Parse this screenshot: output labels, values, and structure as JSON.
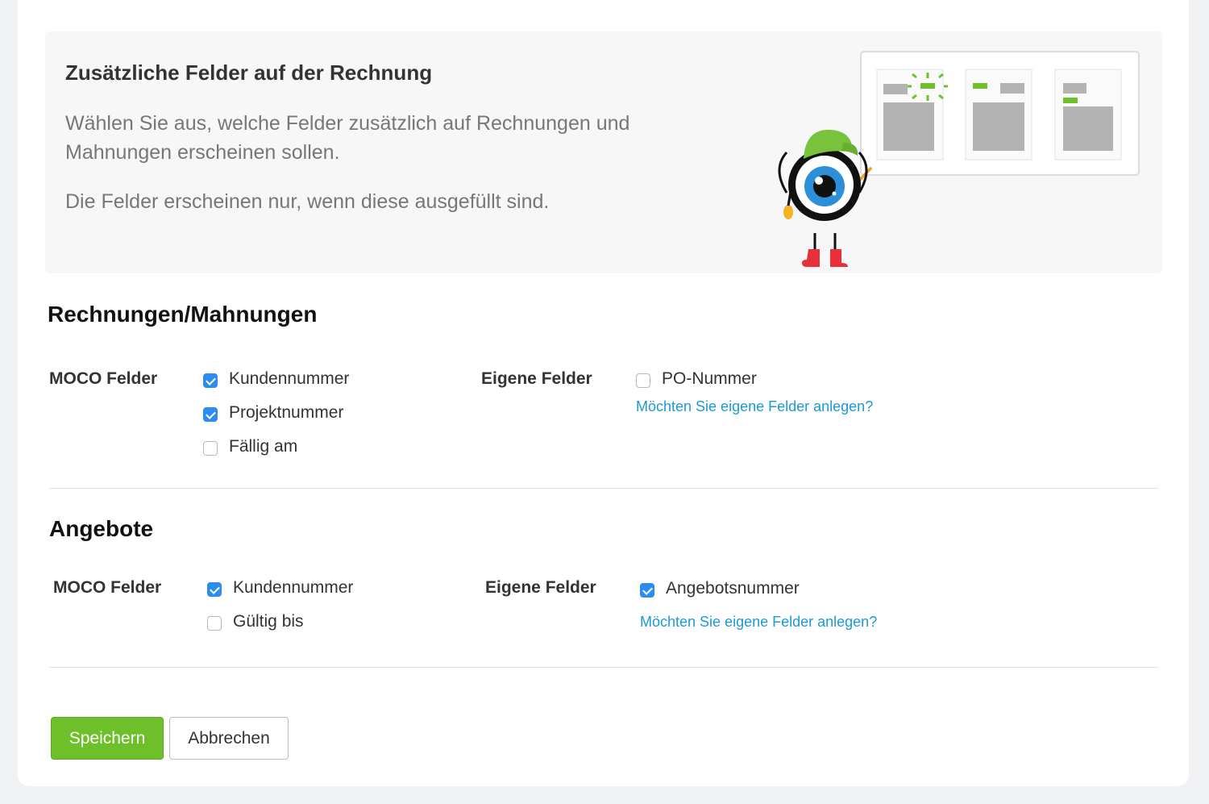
{
  "intro": {
    "title": "Zusätzliche Felder auf der Rechnung",
    "text": "Wählen Sie aus, welche Felder zusätzlich auf Rechnungen und Mahnungen erscheinen sollen.",
    "note": "Die Felder erscheinen nur, wenn diese ausgefüllt sind."
  },
  "invoices": {
    "title": "Rechnungen/Mahnungen",
    "moco_label": "MOCO Felder",
    "moco_fields": [
      {
        "label": "Kundennummer",
        "checked": true
      },
      {
        "label": "Projektnummer",
        "checked": true
      },
      {
        "label": "Fällig am",
        "checked": false
      }
    ],
    "custom_label": "Eigene Felder",
    "custom_fields": [
      {
        "label": "PO-Nummer",
        "checked": false
      }
    ],
    "custom_link": "Möchten Sie eigene Felder anlegen?"
  },
  "offers": {
    "title": "Angebote",
    "moco_label": "MOCO Felder",
    "moco_fields": [
      {
        "label": "Kundennummer",
        "checked": true
      },
      {
        "label": "Gültig bis",
        "checked": false
      }
    ],
    "custom_label": "Eigene Felder",
    "custom_fields": [
      {
        "label": "Angebotsnummer",
        "checked": true
      }
    ],
    "custom_link": "Möchten Sie eigene Felder anlegen?"
  },
  "actions": {
    "save": "Speichern",
    "cancel": "Abbrechen"
  },
  "colors": {
    "accent_green": "#6ec02a",
    "checkbox_blue": "#2d8cf0",
    "link_blue": "#1a9ad6"
  }
}
